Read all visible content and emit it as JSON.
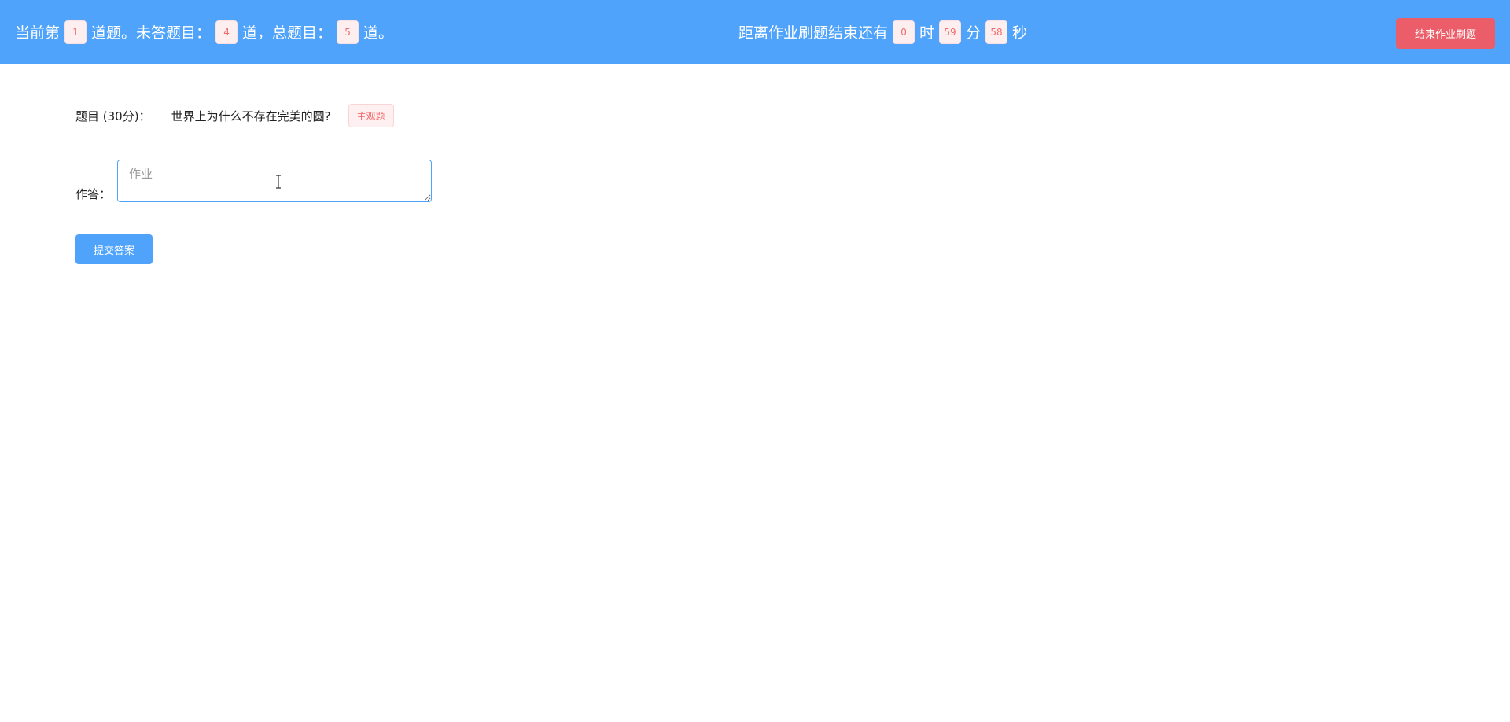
{
  "header": {
    "progress": {
      "prefix": "当前第",
      "current": "1",
      "after_current": "道题。未答题目：",
      "unanswered": "4",
      "after_unanswered": "道，总题目：",
      "total": "5",
      "suffix": "道。"
    },
    "timer": {
      "prefix": "距离作业刷题结束还有",
      "hours": "0",
      "hours_unit": "时",
      "minutes": "59",
      "minutes_unit": "分",
      "seconds": "58",
      "seconds_unit": "秒"
    },
    "end_button_label": "结束作业刷题"
  },
  "question": {
    "label": "题目 (30分)：",
    "text": "世界上为什么不存在完美的圆?",
    "type_tag": "主观题"
  },
  "answer": {
    "label": "作答：",
    "placeholder": "作业",
    "value": ""
  },
  "submit_label": "提交答案",
  "colors": {
    "header_bg": "#4fa3fb",
    "end_button_bg": "#ea5d69",
    "submit_button_bg": "#4fa3fb",
    "pill_text": "#f06c6c",
    "tag_text": "#f56c6c"
  }
}
